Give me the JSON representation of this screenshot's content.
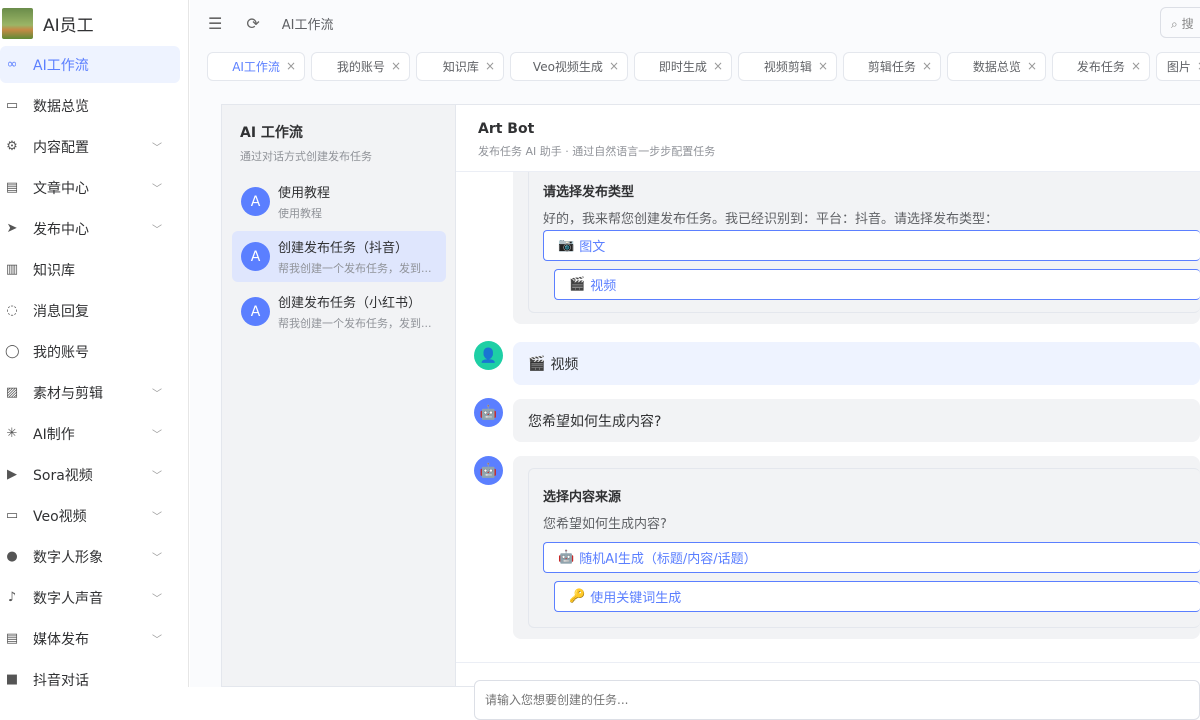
{
  "app": {
    "title": "AI员工"
  },
  "sidebar": {
    "items": [
      {
        "label": "AI工作流",
        "icon": "workflow-icon",
        "active": true,
        "expandable": false
      },
      {
        "label": "数据总览",
        "icon": "chart-icon",
        "expandable": false
      },
      {
        "label": "内容配置",
        "icon": "gear-icon",
        "expandable": true
      },
      {
        "label": "文章中心",
        "icon": "document-icon",
        "expandable": true
      },
      {
        "label": "发布中心",
        "icon": "send-icon",
        "expandable": true
      },
      {
        "label": "知识库",
        "icon": "book-icon",
        "expandable": false
      },
      {
        "label": "消息回复",
        "icon": "message-icon",
        "expandable": false
      },
      {
        "label": "我的账号",
        "icon": "user-icon",
        "expandable": false
      },
      {
        "label": "素材与剪辑",
        "icon": "image-icon",
        "expandable": true
      },
      {
        "label": "AI制作",
        "icon": "sparkle-icon",
        "expandable": true
      },
      {
        "label": "Sora视频",
        "icon": "play-icon",
        "expandable": true
      },
      {
        "label": "Veo视频",
        "icon": "video-icon",
        "expandable": true
      },
      {
        "label": "数字人形象",
        "icon": "person-icon",
        "expandable": true
      },
      {
        "label": "数字人声音",
        "icon": "microphone-icon",
        "expandable": true
      },
      {
        "label": "媒体发布",
        "icon": "document-icon",
        "expandable": true
      },
      {
        "label": "抖音对话",
        "icon": "dark-icon",
        "expandable": false
      }
    ]
  },
  "header": {
    "breadcrumb": "AI工作流",
    "search_placeholder": "搜"
  },
  "tabs": [
    {
      "label": "AI工作流",
      "active": true
    },
    {
      "label": "我的账号"
    },
    {
      "label": "知识库"
    },
    {
      "label": "Veo视频生成"
    },
    {
      "label": "即时生成"
    },
    {
      "label": "视频剪辑"
    },
    {
      "label": "剪辑任务"
    },
    {
      "label": "数据总览"
    },
    {
      "label": "发布任务"
    },
    {
      "label": "图片"
    }
  ],
  "workflow_panel": {
    "title": "AI 工作流",
    "subtitle": "通过对话方式创建发布任务",
    "conversations": [
      {
        "avatar": "A",
        "title": "使用教程",
        "subtitle": "使用教程"
      },
      {
        "avatar": "A",
        "title": "创建发布任务（抖音）",
        "subtitle": "帮我创建一个发布任务，发到...",
        "active": true
      },
      {
        "avatar": "A",
        "title": "创建发布任务（小红书）",
        "subtitle": "帮我创建一个发布任务，发到..."
      }
    ]
  },
  "chat": {
    "title": "Art Bot",
    "subtitle": "发布任务 AI 助手 · 通过自然语言一步步配置任务",
    "card1": {
      "title": "请选择发布类型",
      "text": "好的，我来帮您创建发布任务。我已经识别到：平台：抖音。请选择发布类型：",
      "options": [
        {
          "emoji": "📷",
          "label": "图文"
        },
        {
          "emoji": "🎬",
          "label": "视频"
        }
      ]
    },
    "user_msg": {
      "emoji": "🎬",
      "text": "视频"
    },
    "bot_msg": "您希望如何生成内容?",
    "card2": {
      "title": "选择内容来源",
      "text": "您希望如何生成内容?",
      "options": [
        {
          "emoji": "🤖",
          "label": "随机AI生成（标题/内容/话题）"
        },
        {
          "emoji": "🔑",
          "label": "使用关键词生成"
        }
      ]
    },
    "input_placeholder": "请输入您想要创建的任务..."
  },
  "colors": {
    "accent": "#5b7fff",
    "active_bg": "#eef3ff",
    "user_avatar": "#1ecfa5"
  }
}
